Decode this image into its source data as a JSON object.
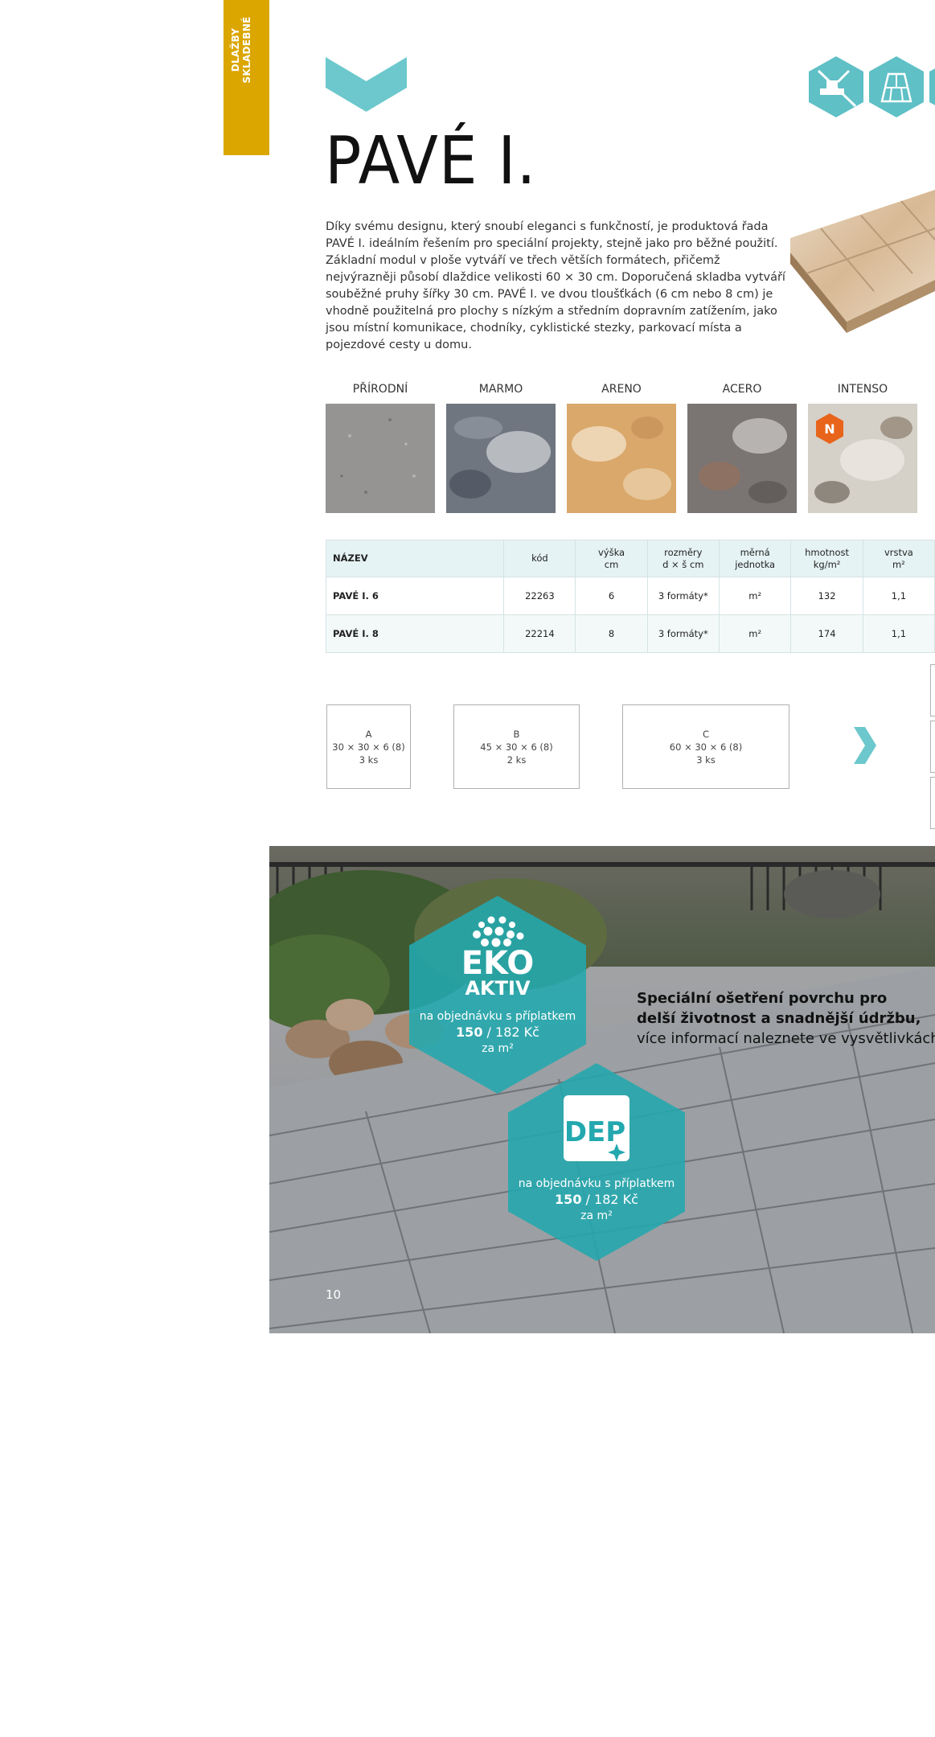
{
  "side_tab": {
    "line1": "DLAŽBY",
    "line2": "SKLADEBNÉ"
  },
  "title": "PAVÉ I.",
  "description": "Díky svému designu, který snoubí eleganci s funkčností, je produktová řada PAVÉ I. ideálním řešením pro speciální projekty, stejně jako pro běžné použití. Základní modul v ploše vytváří ve třech větších formátech, přičemž nejvýrazněji působí dlaždice velikosti 60 × 30 cm. Doporučená skladba vytváří souběžné pruhy šířky 30 cm. PAVÉ I. ve dvou tloušťkách (6 cm nebo 8 cm) je vhodně použitelná pro plochy s nízkým a středním dopravním zatížením, jako jsou místní komunikace, chodníky, cyklistické stezky, parkovací místa a pojezdové cesty u domu.",
  "colors": {
    "accent_teal": "#6cc8cc",
    "tab_yellow": "#dba600",
    "badge_orange": "#e8641b"
  },
  "swatches": [
    {
      "label": "PŘÍRODNÍ"
    },
    {
      "label": "MARMO"
    },
    {
      "label": "ARENO"
    },
    {
      "label": "ACERO"
    },
    {
      "label": "INTENSO",
      "badge": "N"
    }
  ],
  "table": {
    "headers": {
      "name": "NÁZEV",
      "code": "kód",
      "height": [
        "výška",
        "cm"
      ],
      "dims": [
        "rozměry",
        "d × š cm"
      ],
      "unit": [
        "měrná",
        "jednotka"
      ],
      "weight": [
        "hmotnost",
        "kg/m²"
      ],
      "layer": [
        "vrstva",
        "m²"
      ]
    },
    "rows": [
      {
        "name": "PAVÉ I. 6",
        "code": "22263",
        "height": "6",
        "dims": "3 formáty*",
        "unit": "m²",
        "weight": "132",
        "layer": "1,1"
      },
      {
        "name": "PAVÉ I. 8",
        "code": "22214",
        "height": "8",
        "dims": "3 formáty*",
        "unit": "m²",
        "weight": "174",
        "layer": "1,1"
      }
    ]
  },
  "formats": [
    {
      "letter": "A",
      "size": "30 × 30 × 6 (8)",
      "count": "3 ks"
    },
    {
      "letter": "B",
      "size": "45 × 30 × 6 (8)",
      "count": "2 ks"
    },
    {
      "letter": "C",
      "size": "60 × 30 × 6 (8)",
      "count": "3 ks"
    }
  ],
  "promo": {
    "line1": "Speciální ošetření povrchu pro",
    "line2": "delší životnost a snadnější údržbu,",
    "line3": "více informací naleznete ve vysvětlivkách."
  },
  "eko_badge": {
    "logo_line1": "EKO",
    "logo_line2": "AKTIV",
    "note": "na objednávku s příplatkem",
    "price_bold": "150",
    "price_rest": " / 182 Kč",
    "per": "za m²"
  },
  "dep_badge": {
    "logo": "DEP",
    "note": "na objednávku s příplatkem",
    "price_bold": "150",
    "price_rest": " / 182 Kč",
    "per": "za m²"
  },
  "page_number": "10"
}
